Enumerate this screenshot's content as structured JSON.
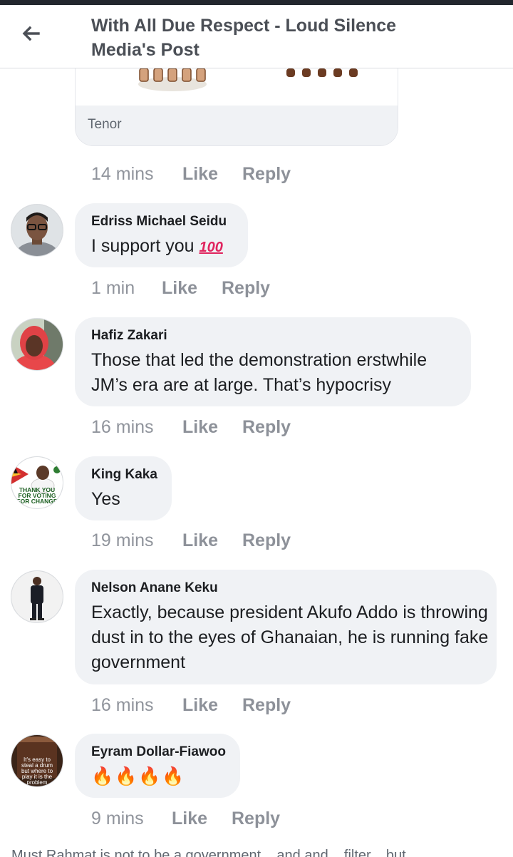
{
  "header": {
    "title": "With All Due Respect - Loud Silence Media's Post"
  },
  "gif": {
    "caption": "Tenor"
  },
  "top_meta": {
    "time": "14 mins",
    "like": "Like",
    "reply": "Reply"
  },
  "comments": [
    {
      "author": "Edriss Michael Seidu",
      "text": "I support you",
      "emoji": "100",
      "time": "1 min",
      "like": "Like",
      "reply": "Reply"
    },
    {
      "author": "Hafiz Zakari",
      "text": "Those that led the demonstration erstwhile JM’s era are at large. That’s hypocrisy",
      "time": "16 mins",
      "like": "Like",
      "reply": "Reply"
    },
    {
      "author": "King Kaka",
      "text": "Yes",
      "avatar_text": "THANK YOU FOR VOTING FOR CHANGE",
      "time": "19 mins",
      "like": "Like",
      "reply": "Reply"
    },
    {
      "author": "Nelson Anane Keku",
      "text": "Exactly, because president Akufo Addo is throwing dust in to the eyes of Ghanaian, he is running fake government",
      "time": "16 mins",
      "like": "Like",
      "reply": "Reply"
    },
    {
      "author": "Eyram Dollar-Fiawoo",
      "text": "🔥🔥🔥🔥",
      "avatar_text": "It's easy to steal a drum but where to play it is the problem",
      "time": "9 mins",
      "like": "Like",
      "reply": "Reply"
    }
  ],
  "bottom_partial": "Must Rahmat is not to be a government... and and... filter... but..."
}
